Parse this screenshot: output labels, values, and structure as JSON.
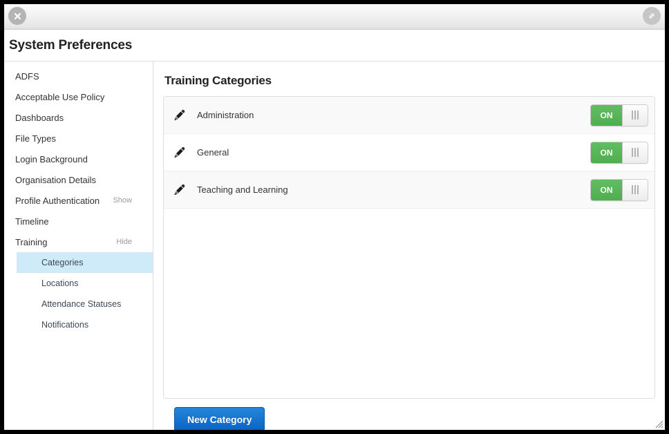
{
  "window": {
    "close_icon": "close-icon",
    "resize_icon": "resize-diagonal-icon",
    "corner_grip_icon": "resize-grip-icon"
  },
  "header": {
    "title": "System Preferences"
  },
  "sidebar": {
    "items": [
      {
        "label": "ADFS",
        "toggle": ""
      },
      {
        "label": "Acceptable Use Policy",
        "toggle": ""
      },
      {
        "label": "Dashboards",
        "toggle": ""
      },
      {
        "label": "File Types",
        "toggle": ""
      },
      {
        "label": "Login Background",
        "toggle": ""
      },
      {
        "label": "Organisation Details",
        "toggle": ""
      },
      {
        "label": "Profile Authentication",
        "toggle": "Show"
      },
      {
        "label": "Timeline",
        "toggle": ""
      },
      {
        "label": "Training",
        "toggle": "Hide"
      }
    ],
    "subitems": [
      {
        "label": "Categories",
        "active": true
      },
      {
        "label": "Locations",
        "active": false
      },
      {
        "label": "Attendance Statuses",
        "active": false
      },
      {
        "label": "Notifications",
        "active": false
      }
    ]
  },
  "main": {
    "section_title": "Training Categories",
    "rows": [
      {
        "name": "Administration",
        "edit_icon": "pencil-icon",
        "toggle_label": "ON",
        "toggle_state": "on"
      },
      {
        "name": "General",
        "edit_icon": "pencil-icon",
        "toggle_label": "ON",
        "toggle_state": "on"
      },
      {
        "name": "Teaching and Learning",
        "edit_icon": "pencil-icon",
        "toggle_label": "ON",
        "toggle_state": "on"
      }
    ],
    "new_category_label": "New Category"
  },
  "colors": {
    "toggle_on_green": "#4fae4f",
    "primary_blue": "#0b62c4",
    "active_nav": "#cfeaf8"
  }
}
